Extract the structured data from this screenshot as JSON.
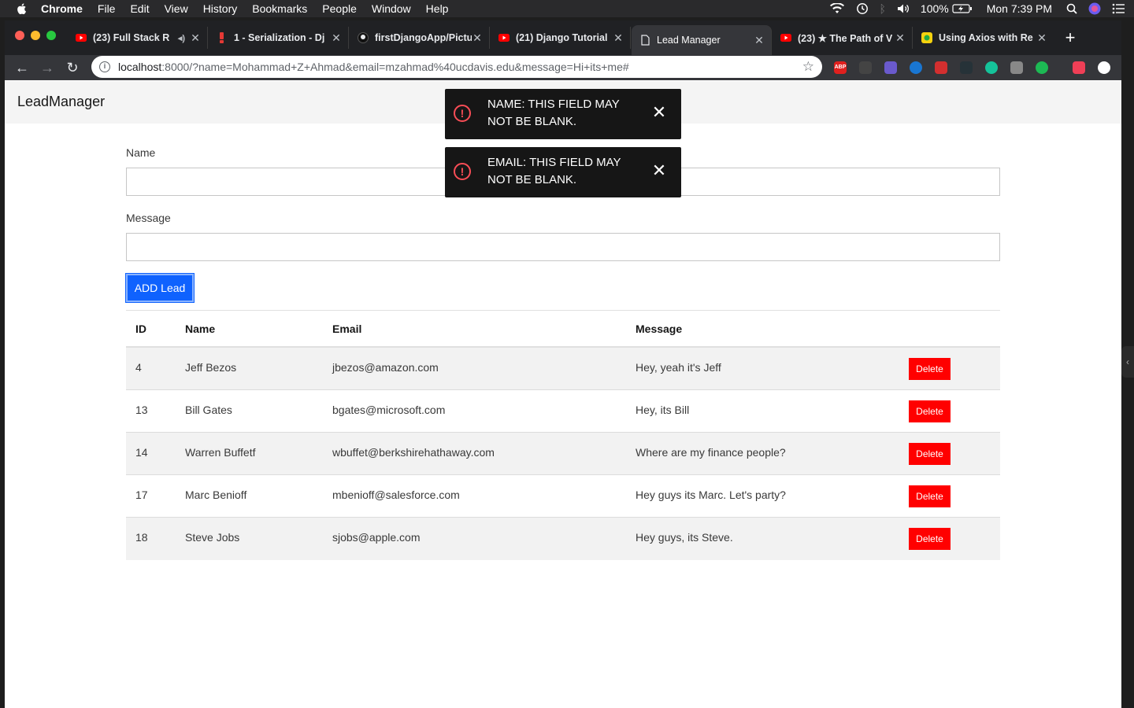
{
  "menubar": {
    "app": "Chrome",
    "items": [
      "File",
      "Edit",
      "View",
      "History",
      "Bookmarks",
      "People",
      "Window",
      "Help"
    ],
    "battery": "100%",
    "clock": "Mon 7:39 PM"
  },
  "tabs": [
    {
      "title": "(23) Full Stack R",
      "icon": "youtube-icon"
    },
    {
      "title": "1 - Serialization - Dj",
      "icon": "django-icon"
    },
    {
      "title": "firstDjangoApp/Pictu",
      "icon": "github-icon"
    },
    {
      "title": "(21) Django Tutorial",
      "icon": "youtube-icon"
    },
    {
      "title": "Lead Manager",
      "icon": "page-icon",
      "active": true
    },
    {
      "title": "(23) ★ The Path of V",
      "icon": "youtube-icon"
    },
    {
      "title": "Using Axios with Re",
      "icon": "blog-icon"
    }
  ],
  "omnibox": {
    "host": "localhost",
    "rest": ":8000/?name=Mohammad+Z+Ahmad&email=mzahmad%40ucdavis.edu&message=Hi+its+me#"
  },
  "extensions": [
    "ABP"
  ],
  "app": {
    "brand": "LeadManager",
    "form": {
      "name_label": "Name",
      "message_label": "Message",
      "add_button": "ADD Lead"
    },
    "table": {
      "headers": [
        "ID",
        "Name",
        "Email",
        "Message"
      ],
      "delete_label": "Delete",
      "rows": [
        {
          "id": "4",
          "name": "Jeff Bezos",
          "email": "jbezos@amazon.com",
          "message": "Hey, yeah it's Jeff"
        },
        {
          "id": "13",
          "name": "Bill Gates",
          "email": "bgates@microsoft.com",
          "message": "Hey, its Bill"
        },
        {
          "id": "14",
          "name": "Warren Buffetf",
          "email": "wbuffet@berkshirehathaway.com",
          "message": "Where are my finance people?"
        },
        {
          "id": "17",
          "name": "Marc Benioff",
          "email": "mbenioff@salesforce.com",
          "message": "Hey guys its Marc. Let's party?"
        },
        {
          "id": "18",
          "name": "Steve Jobs",
          "email": "sjobs@apple.com",
          "message": "Hey guys, its Steve."
        }
      ]
    },
    "toasts": [
      {
        "message": "NAME: THIS FIELD MAY NOT BE BLANK."
      },
      {
        "message": "EMAIL: THIS FIELD MAY NOT BE BLANK."
      }
    ]
  },
  "colors": {
    "primary": "#0f62fe",
    "danger": "#ff0000",
    "toast_bg": "#161616",
    "toast_icon": "#fa4d56"
  }
}
